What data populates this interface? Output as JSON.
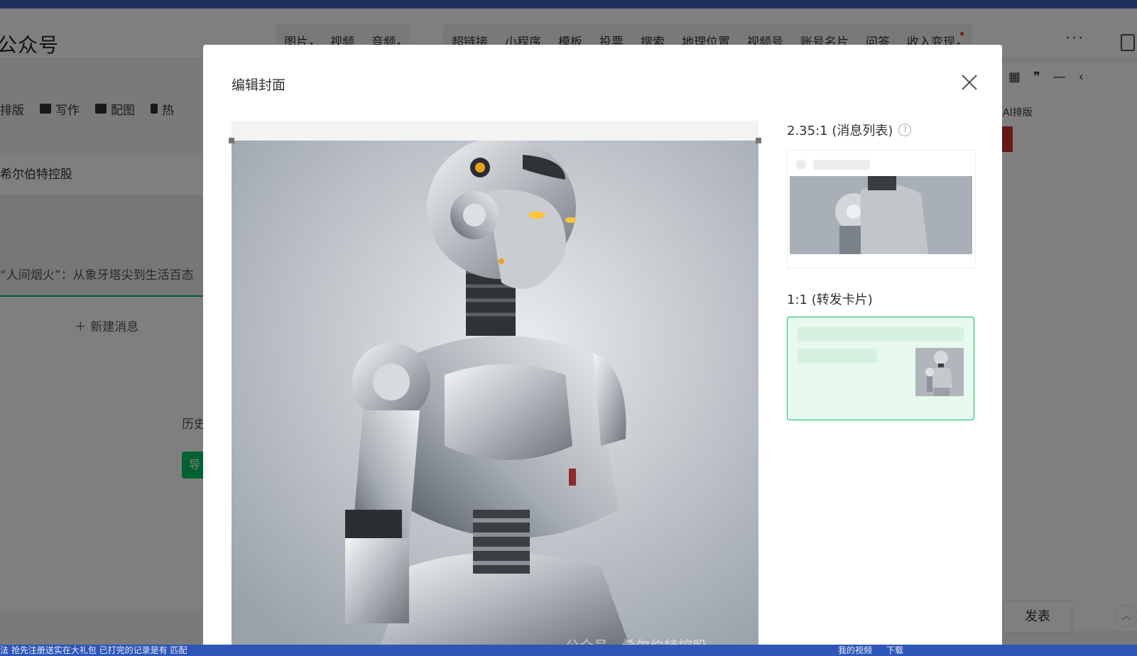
{
  "brand": {
    "title": "公众号"
  },
  "toolbar": {
    "group1": [
      {
        "label": "图片",
        "caret": true
      },
      {
        "label": "视频",
        "caret": false
      },
      {
        "label": "音频",
        "caret": true
      }
    ],
    "group2": [
      {
        "label": "超链接"
      },
      {
        "label": "小程序"
      },
      {
        "label": "模板"
      },
      {
        "label": "投票"
      },
      {
        "label": "搜索"
      },
      {
        "label": "地理位置"
      },
      {
        "label": "视频号"
      },
      {
        "label": "账号名片"
      },
      {
        "label": "问答"
      },
      {
        "label": "收入变现"
      }
    ],
    "more": "···"
  },
  "subbar": {
    "items": [
      {
        "label": "排版"
      },
      {
        "label": "写作"
      },
      {
        "label": "配图"
      },
      {
        "label": "热"
      }
    ]
  },
  "left_panel": {
    "account_title": "希尔伯特控股",
    "article_title": "“人间烟火”：从象牙塔尖到生活百态",
    "new_message": "新建消息",
    "history": "历史",
    "green_button": "导"
  },
  "right_panel": {
    "ai_label": "AI排版",
    "publish": "发表"
  },
  "taskbar": {
    "left_text": "法  抢先注册送实在大礼包  已打完的记录是有 匹配",
    "right_items": [
      "我的视频",
      "下载"
    ]
  },
  "modal": {
    "title": "编辑封面",
    "watermark": "公众号 · 希尔伯特控股",
    "preview_a_label": "2.35:1 (消息列表)",
    "preview_b_label": "1:1 (转发卡片)",
    "colors": {
      "accent": "#07c160",
      "accent_bg": "#e7f8ee"
    }
  }
}
